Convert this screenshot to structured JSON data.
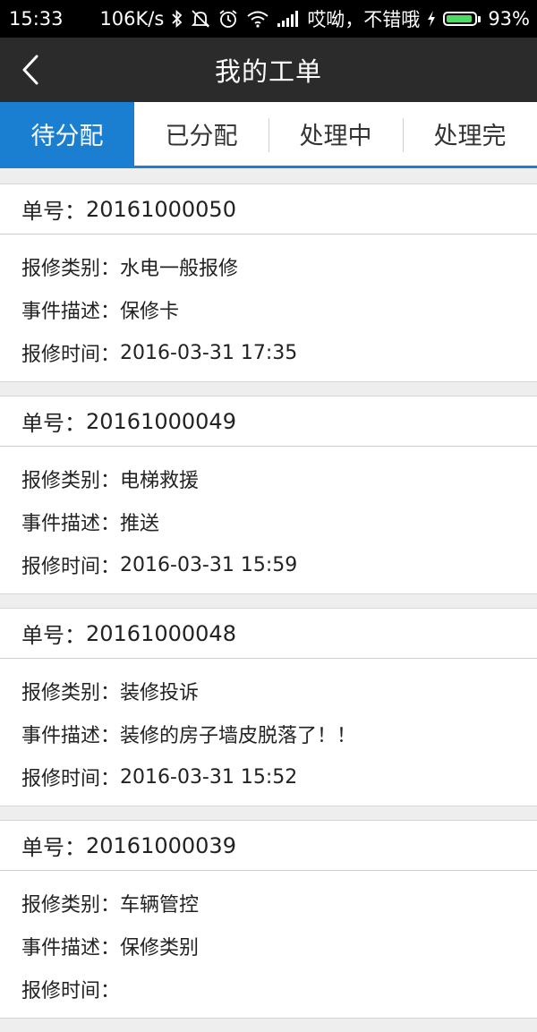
{
  "status_bar": {
    "time": "15:33",
    "speed": "106K/s",
    "carrier": "哎呦，不错哦",
    "battery_percent": "93%",
    "battery_level": 0.93,
    "icons": [
      "bluetooth-icon",
      "mute-icon",
      "alarm-icon",
      "wifi-icon",
      "signal-icon",
      "charging-icon",
      "battery-icon"
    ]
  },
  "app_bar": {
    "title": "我的工单",
    "back_icon": "back-arrow-icon"
  },
  "tabs": [
    {
      "label": "待分配",
      "active": true
    },
    {
      "label": "已分配",
      "active": false
    },
    {
      "label": "处理中",
      "active": false
    },
    {
      "label": "处理完",
      "active": false
    }
  ],
  "colors": {
    "accent": "#1a7fd0",
    "app_bar_bg": "#2b2b2b",
    "page_bg": "#eeeeee"
  },
  "orders": [
    {
      "number_label": "单号：",
      "number": "20161000050",
      "type_label": "报修类别：",
      "type": "水电一般报修",
      "desc_label": "事件描述：",
      "desc": "保修卡",
      "time_label": "报修时间：",
      "time": "2016-03-31 17:35"
    },
    {
      "number_label": "单号：",
      "number": "20161000049",
      "type_label": "报修类别：",
      "type": "电梯救援",
      "desc_label": "事件描述：",
      "desc": "推送",
      "time_label": "报修时间：",
      "time": "2016-03-31 15:59"
    },
    {
      "number_label": "单号：",
      "number": "20161000048",
      "type_label": "报修类别：",
      "type": "装修投诉",
      "desc_label": "事件描述：",
      "desc": "装修的房子墙皮脱落了！！",
      "time_label": "报修时间：",
      "time": "2016-03-31 15:52"
    },
    {
      "number_label": "单号：",
      "number": "20161000039",
      "type_label": "报修类别：",
      "type": "车辆管控",
      "desc_label": "事件描述：",
      "desc": "保修类别",
      "time_label": "报修时间：",
      "time": ""
    }
  ]
}
